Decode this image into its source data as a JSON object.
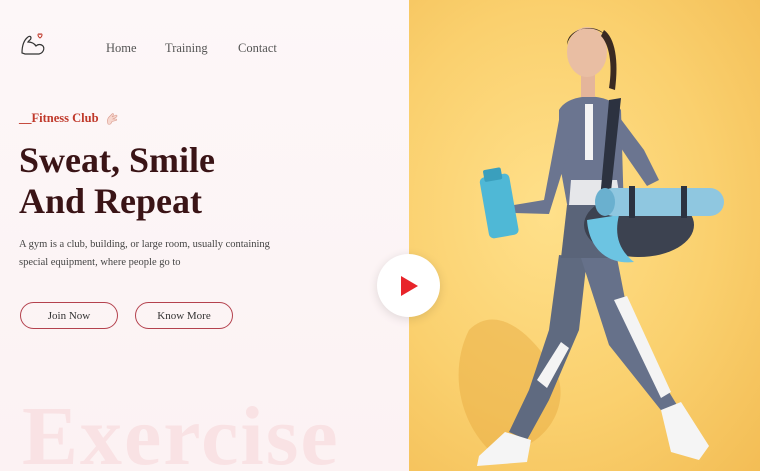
{
  "nav": {
    "items": [
      "Home",
      "Training",
      "Contact"
    ]
  },
  "hero": {
    "tagline": "__Fitness Club",
    "title_line1": "Sweat, Smile",
    "title_line2": "And Repeat",
    "description": "A gym is a club, building, or large room, usually containing special equipment, where people go to",
    "join_label": "Join Now",
    "more_label": "Know More",
    "watermark": "Exercise"
  },
  "icons": {
    "logo": "flexed-arm-heart-icon",
    "tagline": "hand-icon",
    "play": "play-icon"
  },
  "colors": {
    "accent": "#c0392b",
    "title": "#3a1416",
    "button_border": "#b4424e",
    "play": "#e8242a",
    "hero_bg": "#fad06e",
    "page_bg": "#fdf5f6"
  }
}
